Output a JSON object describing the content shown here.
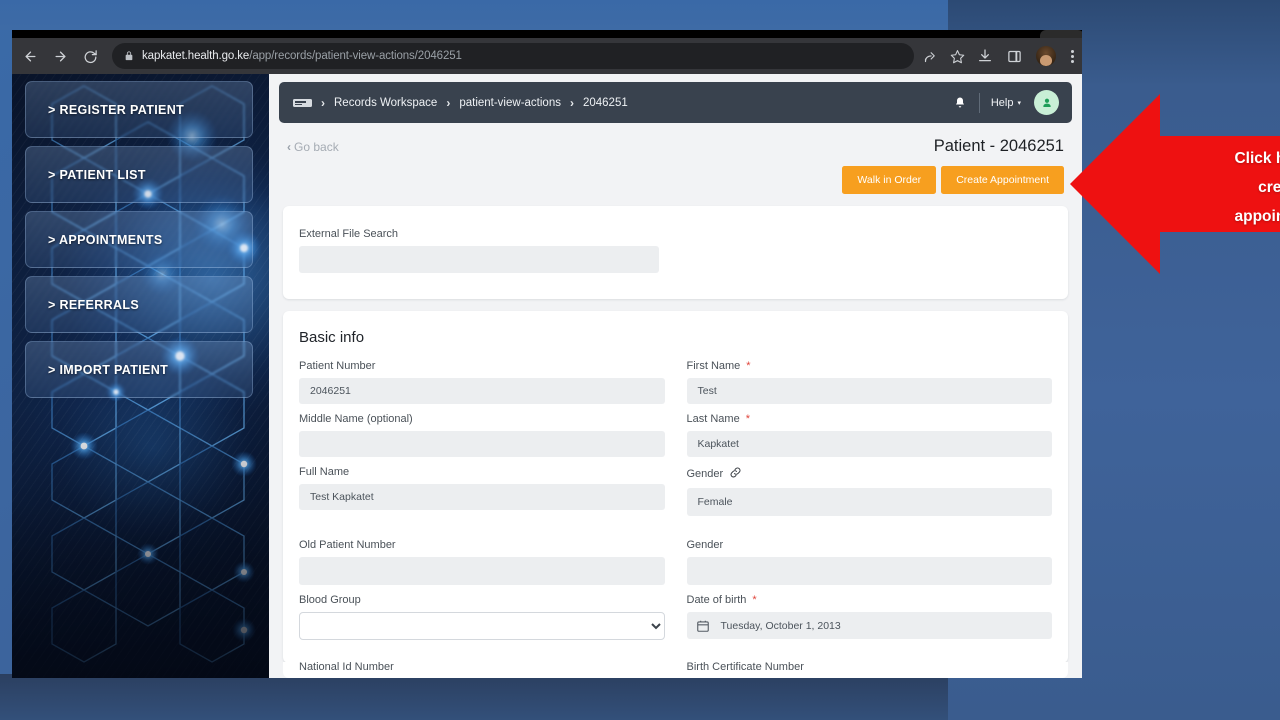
{
  "browser": {
    "url_domain": "kapkatet.health.go.ke",
    "url_path": "/app/records/patient-view-actions/2046251",
    "back_icon": "back-arrow-icon",
    "forward_icon": "forward-arrow-icon",
    "reload_icon": "reload-icon",
    "lock_icon": "lock-icon",
    "share_icon": "share-icon",
    "bookmark_icon": "star-icon",
    "download_icon": "download-icon",
    "sidepanel_icon": "side-panel-icon",
    "profile_icon": "profile-avatar-icon",
    "menu_icon": "kebab-menu-icon"
  },
  "sidebar": {
    "items": [
      {
        "label": "> REGISTER PATIENT"
      },
      {
        "label": "> PATIENT LIST"
      },
      {
        "label": "> APPOINTMENTS"
      },
      {
        "label": "> REFERRALS"
      },
      {
        "label": "> IMPORT PATIENT"
      }
    ]
  },
  "topbar": {
    "breadcrumb": [
      "Records Workspace",
      "patient-view-actions",
      "2046251"
    ],
    "separator": "›",
    "bell_icon": "notification-bell-icon",
    "help_label": "Help",
    "help_caret": "▾",
    "avatar_icon": "user-avatar-icon"
  },
  "page": {
    "go_back_label": "Go back",
    "go_back_chevron": "‹",
    "title": "Patient - 2046251",
    "buttons": {
      "walk_in_order": "Walk in Order",
      "create_appointment": "Create Appointment"
    },
    "accent_orange": "#f79f1f"
  },
  "search_card": {
    "label": "External File Search",
    "value": "",
    "placeholder": ""
  },
  "basic_info": {
    "section_title": "Basic info",
    "left_fields": [
      {
        "label": "Patient Number",
        "value": "2046251",
        "type": "text"
      },
      {
        "label": "Middle Name (optional)",
        "value": "",
        "type": "text"
      },
      {
        "label": "Full Name",
        "value": "Test Kapkatet",
        "type": "text"
      },
      {
        "label": "Old Patient Number",
        "value": "",
        "type": "text"
      },
      {
        "label": "Blood Group",
        "value": "",
        "type": "select"
      }
    ],
    "right_fields": [
      {
        "label": "First Name",
        "value": "Test",
        "type": "text",
        "required": true
      },
      {
        "label": "Last Name",
        "value": "Kapkatet",
        "type": "text",
        "required": true
      },
      {
        "label": "Gender",
        "value": "Female",
        "type": "text",
        "icon": "link-icon"
      },
      {
        "label": "Gender",
        "value": "",
        "type": "text"
      },
      {
        "label": "Date of birth",
        "value": "Tuesday, October 1, 2013",
        "type": "date",
        "required": true,
        "icon": "calendar-icon"
      }
    ],
    "clipped_labels": [
      "National Id Number",
      "Birth Certificate Number"
    ],
    "required_marker": "*"
  },
  "callout": {
    "text_line1": "Click here to",
    "text_line2": "create",
    "text_line3": "appointment",
    "color": "#ee1111"
  }
}
